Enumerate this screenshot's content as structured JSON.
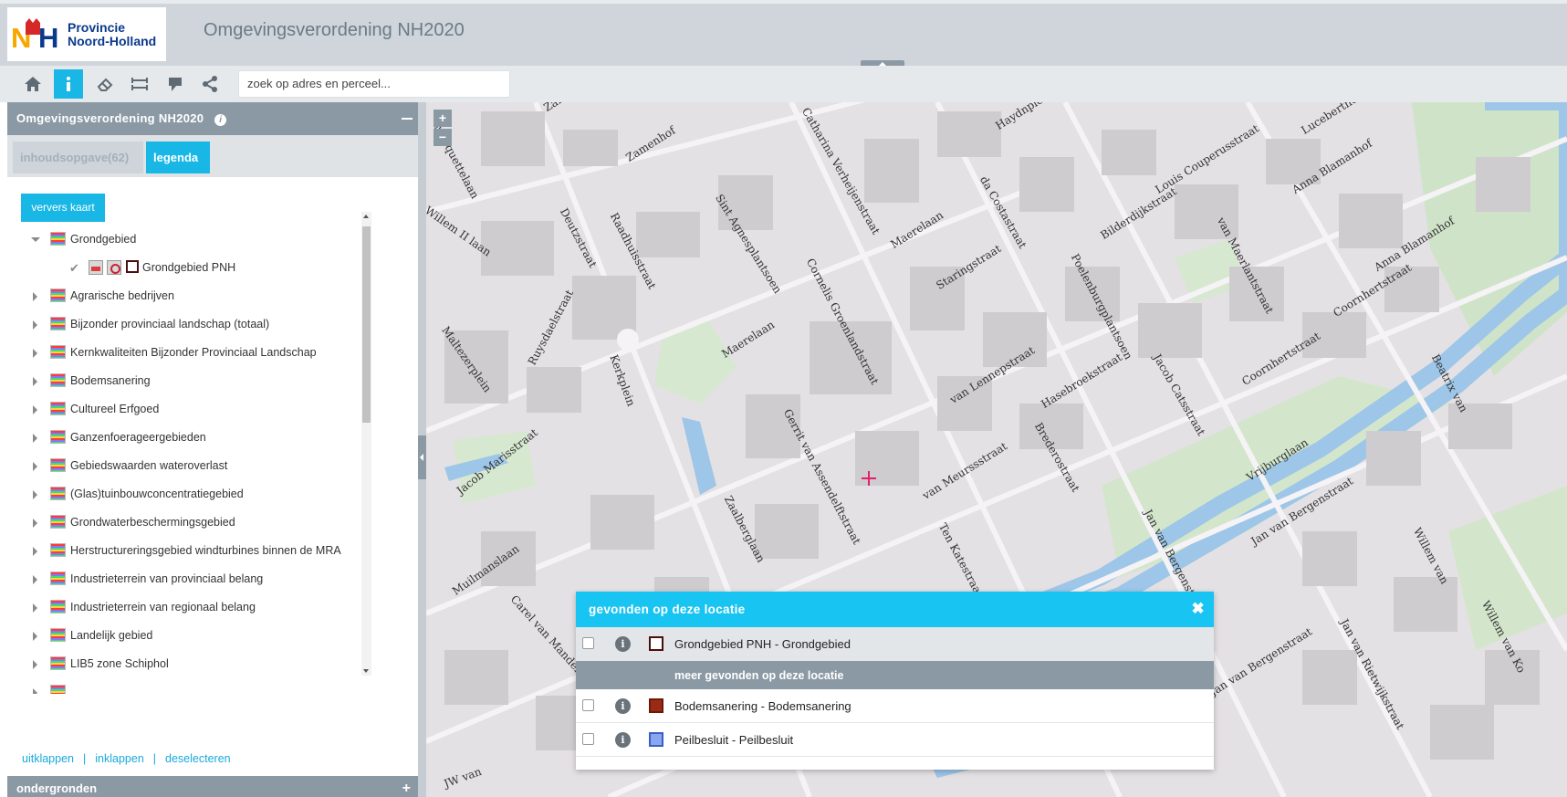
{
  "header": {
    "logo_line1": "Provincie",
    "logo_line2": "Noord-Holland",
    "title": "Omgevingsverordening NH2020"
  },
  "toolbar": {
    "buttons": [
      "home-icon",
      "info-icon",
      "eraser-icon",
      "measure-icon",
      "pin-icon",
      "share-icon"
    ],
    "search_placeholder": "zoek op adres en perceel..."
  },
  "panel": {
    "title": "Omgevingsverordening NH2020",
    "tabs": [
      "inhoudsopgave(62)",
      "legenda"
    ],
    "refresh_label": "ververs kaart",
    "tree": [
      {
        "label": "Grondgebied",
        "expanded": true
      },
      {
        "label": "Grondgebied PNH"
      },
      {
        "label": "Agrarische bedrijven"
      },
      {
        "label": "Bijzonder provinciaal landschap (totaal)"
      },
      {
        "label": "Kernkwaliteiten Bijzonder Provinciaal Landschap"
      },
      {
        "label": "Bodemsanering"
      },
      {
        "label": "Cultureel Erfgoed"
      },
      {
        "label": "Ganzenfoerageergebieden"
      },
      {
        "label": "Gebiedswaarden wateroverlast"
      },
      {
        "label": "(Glas)tuinbouwconcentratiegebied"
      },
      {
        "label": "Grondwaterbeschermingsgebied"
      },
      {
        "label": "Herstructureringsgebied windturbines binnen de MRA"
      },
      {
        "label": "Industrieterrein van provinciaal belang"
      },
      {
        "label": "Industrieterrein van regionaal belang"
      },
      {
        "label": "Landelijk gebied"
      },
      {
        "label": "LIB5 zone Schiphol"
      }
    ],
    "actions": {
      "expand": "uitklappen",
      "collapse": "inklappen",
      "deselect": "deselecteren"
    },
    "bottom_title": "ondergronden"
  },
  "map": {
    "streets": [
      "Marquettelaan",
      "Zamenhof",
      "Haydnplein",
      "Lucebertho",
      "Zamenhof",
      "Catharina Verheijenstraat",
      "Anna Blamanhof",
      "Louis Couperusstraat",
      "Sint Agnesplantsoen",
      "da Costastraat",
      "Deutzstraat",
      "Raadhuisstraat",
      "Willem II laan",
      "Maerelaan",
      "Bilderdijkstraat",
      "van Maerlantstraat",
      "Staringstraat",
      "Anna Blamanhof",
      "Cornelis Groenlandstraat",
      "Poelenburgplantsoen",
      "Coornhertstraat",
      "Maltezerplein",
      "Ruysdaelstraat",
      "Kerkplein",
      "Maerelaan",
      "Jacob Catsstraat",
      "Coornhertstraat",
      "Beatrix van",
      "van Lennepstraat",
      "Hasebroekstraat",
      "Gerrit van Assendelftstraat",
      "Brederostraat",
      "Jacob Marisstraat",
      "van Meurssstraat",
      "Vrijburglaan",
      "Ten Katestraat",
      "Jan van Bergenstraat",
      "Jan van Bergenstraat",
      "Zaalberglaan",
      "Willem van",
      "Muilmanslaan",
      "Carel van Manderstraat",
      "Jan van Bergenstraat",
      "Jan van Rietwijkstraat",
      "Willem van Ko",
      "JW van"
    ]
  },
  "popup": {
    "title": "gevonden op deze locatie",
    "top_row": {
      "label": "Grondgebied PNH - Grondgebied",
      "swatch": "#ffffff",
      "border": "#4a0f0f"
    },
    "more_label": "meer gevonden op deze locatie",
    "rows": [
      {
        "label": "Bodemsanering - Bodemsanering",
        "swatch": "#9b2a14",
        "border": "#6b1a0a"
      },
      {
        "label": "Peilbesluit - Peilbesluit",
        "swatch": "#8aa6ef",
        "border": "#3a5fc5"
      }
    ]
  },
  "colors": {
    "accent": "#18b7e6",
    "panel_header": "#8b99a4",
    "crosshair": "#e2206b"
  }
}
